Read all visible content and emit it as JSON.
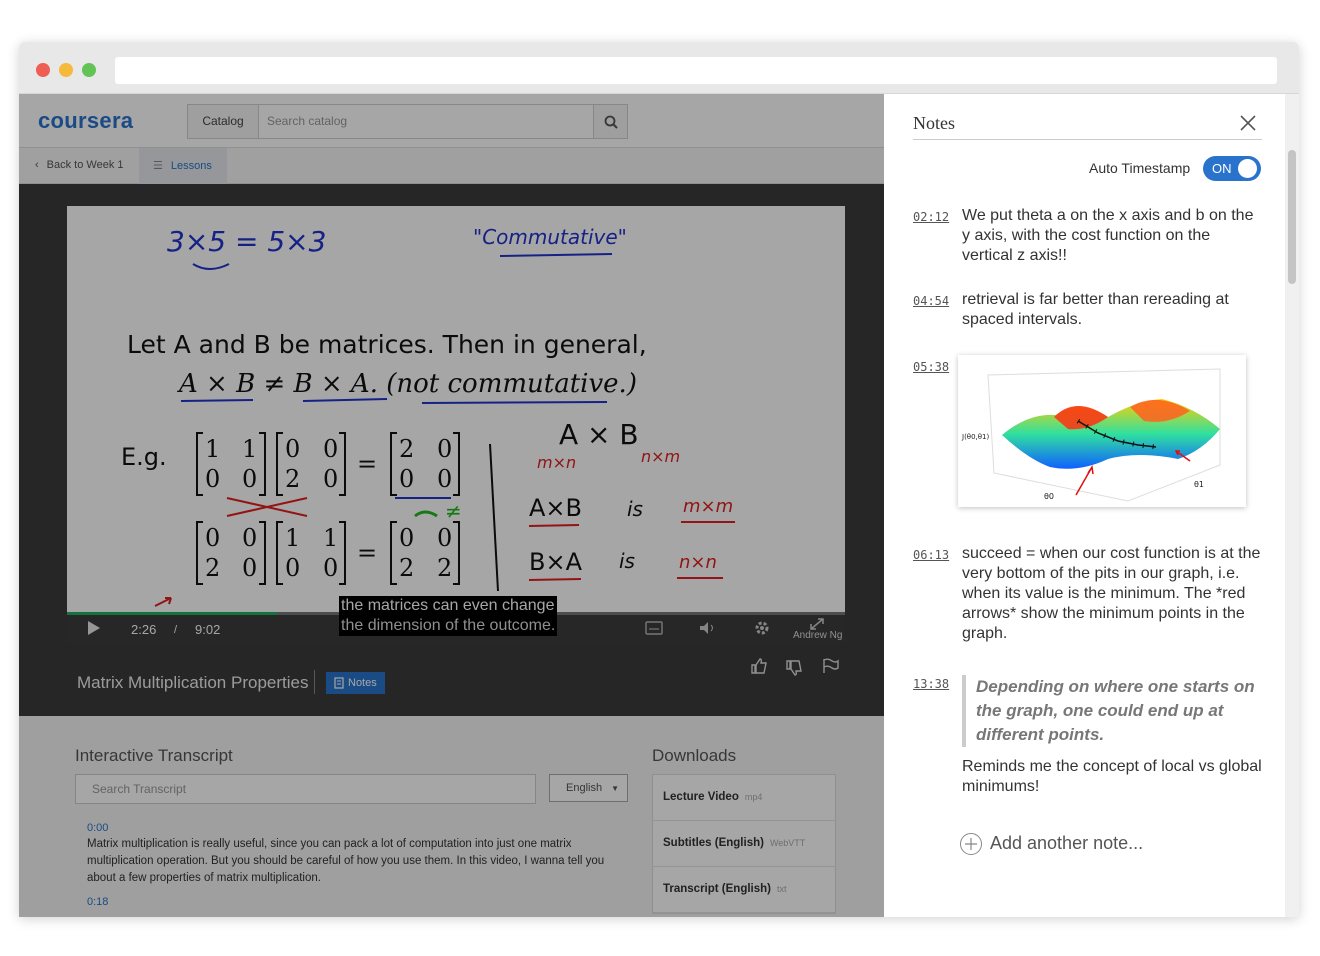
{
  "browser": {
    "dots": [
      "#ee5e53",
      "#f5b93c",
      "#62c454"
    ]
  },
  "site": {
    "logo": "coursera",
    "catalog_label": "Catalog",
    "search_placeholder": "Search catalog"
  },
  "subnav": {
    "back_label": "Back to Week 1",
    "lessons_label": "Lessons"
  },
  "player": {
    "current_time": "2:26",
    "time_separator": "/",
    "duration": "9:02",
    "progress_fraction": 0.27,
    "caption_line1": "the matrices can even change",
    "caption_line2": "the dimension of the outcome.",
    "watermark": "Andrew Ng"
  },
  "slide": {
    "handwritten_1": "3×5  = 5×3",
    "handwritten_2": "\"Commutative\"",
    "text_line1": "Let A and B be matrices. Then in general,",
    "text_line2": "A × B ≠ B × A. (not commutative.)",
    "eg_label": "E.g.",
    "ab": "A × B",
    "mxn": "m×n",
    "nxm": "n×m",
    "axb": "A×B",
    "bxa": "B×A",
    "is": "is",
    "mxm": "m×m",
    "nxn": "n×n",
    "neq": "≠"
  },
  "lecture": {
    "title": "Matrix Multiplication Properties",
    "notes_button": "Notes"
  },
  "transcript": {
    "heading": "Interactive Transcript",
    "search_placeholder": "Search Transcript",
    "language": "English",
    "entries": [
      {
        "time": "0:00",
        "text": "Matrix multiplication is really useful, since you can pack a lot of computation into just one matrix multiplication operation. But you should be careful of how you use them. In this video, I wanna tell you about a few properties of matrix multiplication."
      },
      {
        "time": "0:18",
        "text": ""
      }
    ]
  },
  "downloads": {
    "heading": "Downloads",
    "items": [
      {
        "label": "Lecture Video",
        "format": "mp4"
      },
      {
        "label": "Subtitles (English)",
        "format": "WebVTT"
      },
      {
        "label": "Transcript (English)",
        "format": "txt"
      }
    ]
  },
  "notes": {
    "title": "Notes",
    "auto_timestamp_label": "Auto Timestamp",
    "toggle_label": "ON",
    "items": [
      {
        "time": "02:12",
        "text": "We put theta a on the x axis and b on the y axis, with the cost function on the vertical z axis!!"
      },
      {
        "time": "04:54",
        "text": "retrieval is far better than rereading at spaced intervals."
      },
      {
        "time": "05:38",
        "text": ""
      },
      {
        "time": "06:13",
        "text": "succeed = when our cost function is at the very bottom of the pits in our graph, i.e. when its value is the minimum. The *red arrows* show the minimum points in the graph."
      },
      {
        "time": "13:38",
        "quote": "Depending on where one starts on the graph, one could end up at different points.",
        "text": "Reminds me the concept of local vs global minimums!"
      }
    ],
    "image": {
      "ylabel": "J(θ0,θ1)",
      "xlabel": "θ0",
      "zlabel": "θ1"
    },
    "add_label": "Add another note..."
  }
}
